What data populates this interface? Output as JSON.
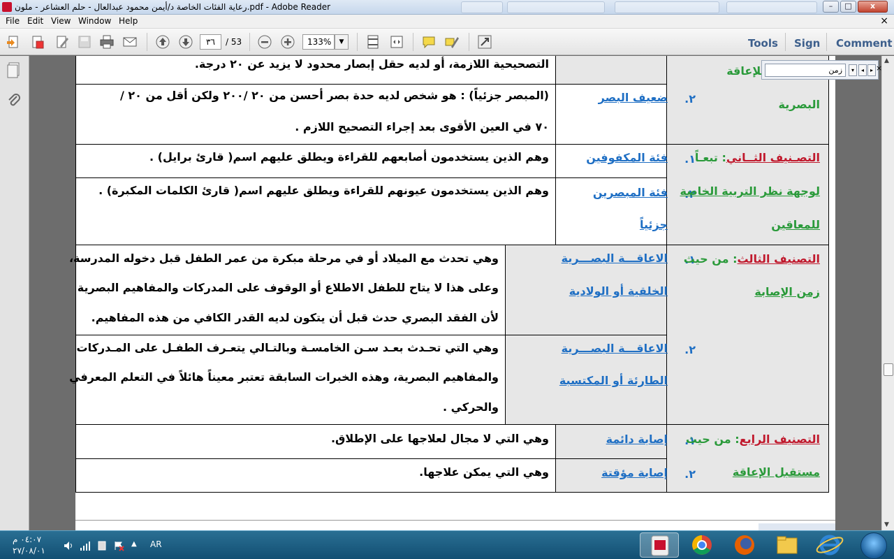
{
  "window": {
    "title": "رعاية الفئات الخاصة د/أيمن محمود عبدالعال - حلم العشاعر - ملون.pdf - Adobe Reader",
    "controls": {
      "minimize": "–",
      "maximize": "□",
      "close": "x"
    }
  },
  "menu": {
    "items": [
      "File",
      "Edit",
      "View",
      "Window",
      "Help"
    ],
    "doc_close": "×"
  },
  "toolbar": {
    "page_current": "٣٦",
    "page_total": "/ 53",
    "zoom": "133%",
    "zoom_arrow": "▼",
    "tools": "Tools",
    "sign": "Sign",
    "comment": "Comment"
  },
  "find": {
    "query": "زمن",
    "prev": "◂",
    "next": "▸",
    "close": "×"
  },
  "table": {
    "rows": [
      {
        "num": "",
        "category": "",
        "desc": [
          "التصحيحية اللازمة، أو لديه حقل إبصار محدود لا يزيد عن ٢٠ درجة."
        ]
      },
      {
        "num": "٢.",
        "category": "ضعيف البصر",
        "desc": [
          "(المبصر جزئياً) : هو شخص لديه حدة بصر أحسن من ٢٠ /٢٠٠ ولكن أقل من ٢٠ /",
          "٧٠ في العين الأقوى بعد إجراء التصحيح اللازم ."
        ]
      },
      {
        "num": "١.",
        "category": "فئة المكفوفين",
        "desc": [
          "وهم الذين يستخدمون أصابعهم للقراءة ويطلق عليهم اسم( قارئ برايل) ."
        ]
      },
      {
        "num": "٢.",
        "category": [
          "فئة المبصرين",
          "جزئياً"
        ],
        "desc": [
          "وهم الذين يستخدمون عيونهم للقراءة ويطلق عليهم اسم( قارئ الكلمات المكبرة) ."
        ]
      },
      {
        "num": "١.",
        "category": [
          "الاعاقـــة البصـــرية",
          "الخلقية أو الولادية"
        ],
        "desc": [
          "وهي تحدث مع الميلاد أو في مرحلة مبكرة من عمر الطفل قبل دخوله المدرسة،",
          "وعلى هذا لا يتاح للطفل الاطلاع أو الوقوف على المدركات والمفاهيم البصرية",
          "لأن الفقد البصري حدث قبل أن يتكون لديه القدر الكافي من هذه المفاهيم."
        ]
      },
      {
        "num": "٢.",
        "category": [
          "الاعاقـــة البصـــرية",
          "الطارئة أو المكتسبة"
        ],
        "desc": [
          "وهي التي تحـدث بعـد سـن الخامسـة وبالتـالي يتعـرف الطفـل على المـدركات",
          "والمفاهيم البصرية، وهذه الخبرات السابقة تعتبر معيناً هائلاً في التعلم المعرفي",
          "والحركي ."
        ]
      },
      {
        "num": "١.",
        "category": "إصابة دائمة",
        "desc": [
          "وهي التي لا مجال لعلاجها على الإطلاق."
        ]
      },
      {
        "num": "٢.",
        "category": "إصابة مؤقتة",
        "desc": [
          "وهي التي يمكن علاجها."
        ]
      }
    ],
    "classifications": [
      {
        "lines": [
          [
            {
              "t": "...قانوني للإعاقة",
              "c": "green"
            }
          ],
          [
            {
              "t": "البصرية",
              "c": "green"
            }
          ]
        ]
      },
      {
        "lines": [
          [
            {
              "t": "التصـنيف الثــاني",
              "c": "red"
            },
            {
              "t": ": تبعـاً",
              "c": "green"
            }
          ],
          [
            {
              "t": "لوجهة نظر التربية الخاصة",
              "c": "green"
            }
          ],
          [
            {
              "t": "للمعاقين",
              "c": "green"
            }
          ]
        ]
      },
      {
        "lines": [
          [
            {
              "t": "التصنيف الثالث",
              "c": "red"
            },
            {
              "t": ": من حيث",
              "c": "green"
            }
          ],
          [
            {
              "t": "زمن الإصابة",
              "c": "green"
            }
          ]
        ]
      },
      {
        "lines": [
          [
            {
              "t": "التصنيف الرابع",
              "c": "red"
            },
            {
              "t": ": من حيث",
              "c": "green"
            }
          ],
          [
            {
              "t": "مستقبل الإعاقة",
              "c": "green"
            }
          ]
        ]
      }
    ]
  },
  "taskbar": {
    "time": "٠٤:٠٧ م",
    "date": "٢٧/٠٨/٠١",
    "language": "AR",
    "apps": [
      "acrobat-icon",
      "chrome-icon",
      "firefox-icon",
      "explorer-icon",
      "ie-icon"
    ]
  },
  "colors": {
    "heading_red": "#c0182c",
    "heading_green": "#2a9a3a",
    "term_blue": "#1f6fc4"
  }
}
